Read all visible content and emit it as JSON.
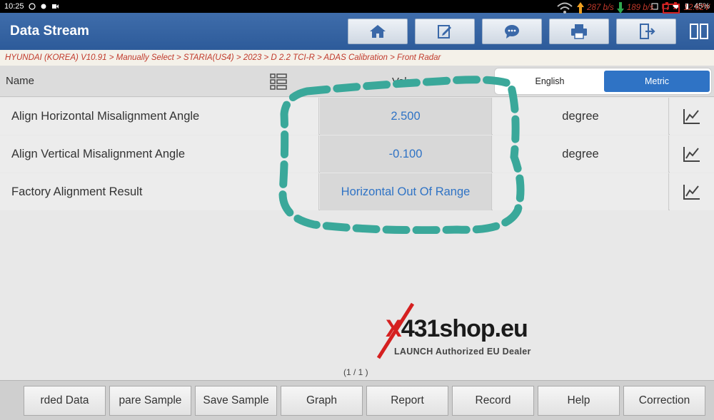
{
  "status": {
    "time": "10:25",
    "battery": "45%"
  },
  "header": {
    "title": "Data Stream",
    "toolbar_icons": [
      "home-icon",
      "edit-icon",
      "chat-icon",
      "print-icon",
      "exit-icon",
      "split-view-icon"
    ]
  },
  "breadcrumb": {
    "path": "HYUNDAI (KOREA) V10.91 > Manually Select > STARIA(US4) > 2023 > D 2.2 TCI-R > ADAS Calibration > Front Radar",
    "upload": "287 b/s",
    "download": "189 b/s",
    "voltage": "12.62V"
  },
  "table": {
    "col_name": "Name",
    "col_value": "Value",
    "unit_english": "English",
    "unit_metric": "Metric",
    "rows": [
      {
        "name": "Align Horizontal Misalignment Angle",
        "value": "2.500",
        "unit": "degree"
      },
      {
        "name": "Align Vertical Misalignment Angle",
        "value": "-0.100",
        "unit": "degree"
      },
      {
        "name": "Factory Alignment Result",
        "value": "Horizontal Out Of Range",
        "unit": ""
      }
    ]
  },
  "pager": "(1 / 1 )",
  "watermark": {
    "brand_x": "X",
    "brand_rest": "431shop.eu",
    "tagline": "LAUNCH Authorized EU Dealer"
  },
  "bottom_buttons": [
    "rded Data",
    "pare Sample",
    "Save Sample",
    "Graph",
    "Report",
    "Record",
    "Help",
    "Correction"
  ],
  "colors": {
    "header_blue": "#2d5b9a",
    "accent_blue": "#2f73c5",
    "breadcrumb_red": "#c0392b",
    "annotation_teal": "#3aa89a"
  }
}
